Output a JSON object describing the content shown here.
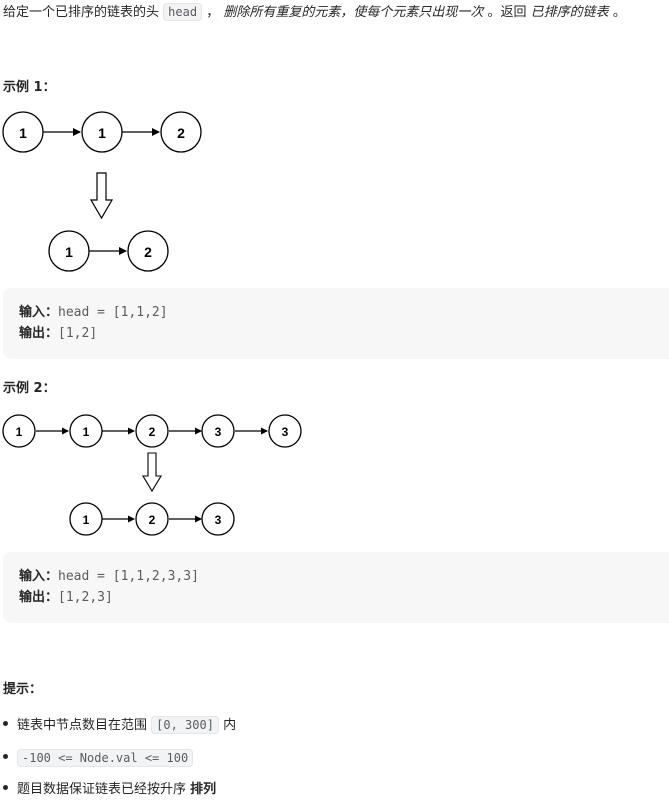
{
  "intro": {
    "prefix": "给定一个已排序的链表的头",
    "head_code": "head",
    "sep1": "，",
    "em1": "删除所有重复的元素，使每个元素只出现一次",
    "sep2": "。返回",
    "em2": "已排序的链表",
    "suffix": "。"
  },
  "examples": [
    {
      "heading": "示例 1：",
      "input_label": "输入：",
      "input_value": "head = [1,1,2]",
      "output_label": "输出：",
      "output_value": "[1,2]",
      "before_nodes": [
        "1",
        "1",
        "2"
      ],
      "after_nodes": [
        "1",
        "2"
      ]
    },
    {
      "heading": "示例 2：",
      "input_label": "输入：",
      "input_value": "head = [1,1,2,3,3]",
      "output_label": "输出：",
      "output_value": "[1,2,3]",
      "before_nodes": [
        "1",
        "1",
        "2",
        "3",
        "3"
      ],
      "after_nodes": [
        "1",
        "2",
        "3"
      ]
    }
  ],
  "hints": {
    "heading": "提示：",
    "item1_prefix": "链表中节点数目在范围",
    "item1_code": "[0, 300]",
    "item1_suffix": "内",
    "item2_code": "-100 <= Node.val <= 100",
    "item3_prefix": "题目数据保证链表已经按升序",
    "item3_bold": "排列"
  }
}
